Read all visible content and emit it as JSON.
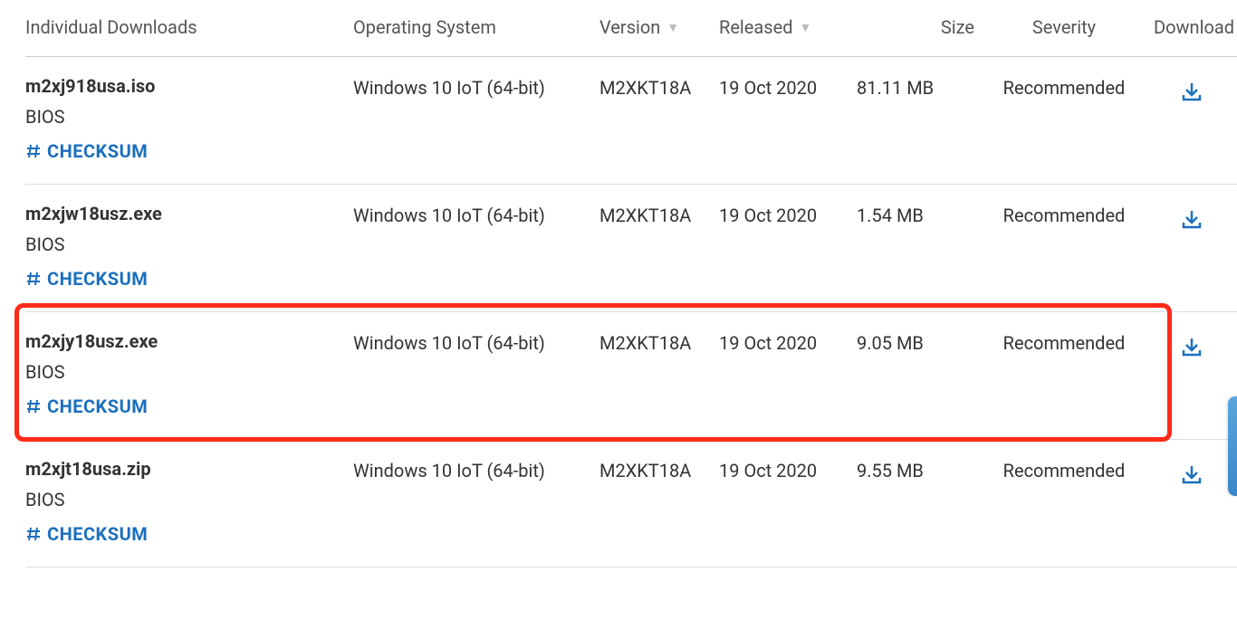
{
  "headers": {
    "individual_downloads": "Individual Downloads",
    "operating_system": "Operating System",
    "version": "Version",
    "released": "Released",
    "size": "Size",
    "severity": "Severity",
    "download": "Download"
  },
  "checksum_label": "CHECKSUM",
  "rows": [
    {
      "filename": "m2xj918usa.iso",
      "category": "BIOS",
      "os": "Windows 10 IoT (64-bit)",
      "version": "M2XKT18A",
      "released": "19 Oct 2020",
      "size": "81.11 MB",
      "severity": "Recommended"
    },
    {
      "filename": "m2xjw18usz.exe",
      "category": "BIOS",
      "os": "Windows 10 IoT (64-bit)",
      "version": "M2XKT18A",
      "released": "19 Oct 2020",
      "size": "1.54 MB",
      "severity": "Recommended"
    },
    {
      "filename": "m2xjy18usz.exe",
      "category": "BIOS",
      "os": "Windows 10 IoT (64-bit)",
      "version": "M2XKT18A",
      "released": "19 Oct 2020",
      "size": "9.05 MB",
      "severity": "Recommended"
    },
    {
      "filename": "m2xjt18usa.zip",
      "category": "BIOS",
      "os": "Windows 10 IoT (64-bit)",
      "version": "M2XKT18A",
      "released": "19 Oct 2020",
      "size": "9.55 MB",
      "severity": "Recommended"
    }
  ],
  "highlighted_row_index": 2,
  "colors": {
    "link": "#1a6fbf",
    "highlight_border": "#ff2a1a"
  }
}
